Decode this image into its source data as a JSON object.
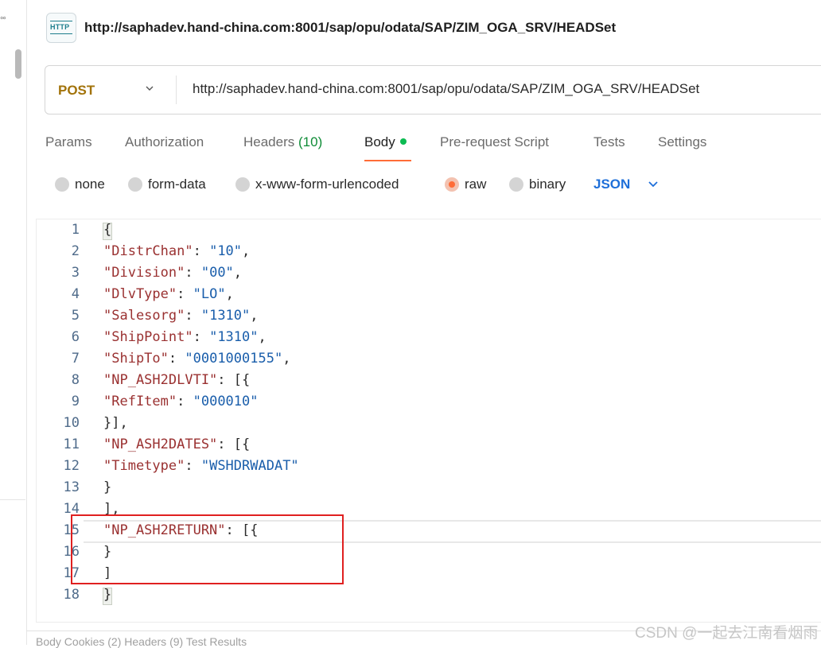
{
  "sidebar": {
    "dots": "°°"
  },
  "request": {
    "title_url": "http://saphadev.hand-china.com:8001/sap/opu/odata/SAP/ZIM_OGA_SRV/HEADSet",
    "method": "POST",
    "url": "http://saphadev.hand-china.com:8001/sap/opu/odata/SAP/ZIM_OGA_SRV/HEADSet",
    "icon_label": "HTTP"
  },
  "tabs": [
    {
      "label": "Params"
    },
    {
      "label": "Authorization"
    },
    {
      "label": "Headers",
      "count": "(10)"
    },
    {
      "label": "Body",
      "active": true
    },
    {
      "label": "Pre-request Script"
    },
    {
      "label": "Tests"
    },
    {
      "label": "Settings"
    }
  ],
  "body_types": [
    {
      "label": "none",
      "selected": false
    },
    {
      "label": "form-data",
      "selected": false
    },
    {
      "label": "x-www-form-urlencoded",
      "selected": false
    },
    {
      "label": "raw",
      "selected": true
    },
    {
      "label": "binary",
      "selected": false
    }
  ],
  "format": "JSON",
  "editor": {
    "line_numbers": [
      "1",
      "2",
      "3",
      "4",
      "5",
      "6",
      "7",
      "8",
      "9",
      "10",
      "11",
      "12",
      "13",
      "14",
      "15",
      "16",
      "17",
      "18"
    ],
    "lines": [
      {
        "parts": [
          {
            "t": "p",
            "v": "{"
          }
        ]
      },
      {
        "parts": [
          {
            "t": "k",
            "v": "\"DistrChan\""
          },
          {
            "t": "p",
            "v": ": "
          },
          {
            "t": "s",
            "v": "\"10\""
          },
          {
            "t": "p",
            "v": ","
          }
        ]
      },
      {
        "parts": [
          {
            "t": "k",
            "v": "\"Division\""
          },
          {
            "t": "p",
            "v": ": "
          },
          {
            "t": "s",
            "v": "\"00\""
          },
          {
            "t": "p",
            "v": ","
          }
        ]
      },
      {
        "parts": [
          {
            "t": "k",
            "v": "\"DlvType\""
          },
          {
            "t": "p",
            "v": ": "
          },
          {
            "t": "s",
            "v": "\"LO\""
          },
          {
            "t": "p",
            "v": ","
          }
        ]
      },
      {
        "parts": [
          {
            "t": "k",
            "v": "\"Salesorg\""
          },
          {
            "t": "p",
            "v": ": "
          },
          {
            "t": "s",
            "v": "\"1310\""
          },
          {
            "t": "p",
            "v": ","
          }
        ]
      },
      {
        "parts": [
          {
            "t": "k",
            "v": "\"ShipPoint\""
          },
          {
            "t": "p",
            "v": ": "
          },
          {
            "t": "s",
            "v": "\"1310\""
          },
          {
            "t": "p",
            "v": ","
          }
        ]
      },
      {
        "parts": [
          {
            "t": "k",
            "v": "\"ShipTo\""
          },
          {
            "t": "p",
            "v": ": "
          },
          {
            "t": "s",
            "v": "\"0001000155\""
          },
          {
            "t": "p",
            "v": ","
          }
        ]
      },
      {
        "parts": [
          {
            "t": "k",
            "v": "\"NP_ASH2DLVTI\""
          },
          {
            "t": "p",
            "v": ": [{"
          }
        ]
      },
      {
        "parts": [
          {
            "t": "k",
            "v": "\"RefItem\""
          },
          {
            "t": "p",
            "v": ": "
          },
          {
            "t": "s",
            "v": "\"000010\""
          }
        ]
      },
      {
        "parts": [
          {
            "t": "p",
            "v": "}],"
          }
        ]
      },
      {
        "parts": [
          {
            "t": "k",
            "v": "\"NP_ASH2DATES\""
          },
          {
            "t": "p",
            "v": ": [{"
          }
        ]
      },
      {
        "parts": [
          {
            "t": "k",
            "v": "\"Timetype\""
          },
          {
            "t": "p",
            "v": ": "
          },
          {
            "t": "s",
            "v": "\"WSHDRWADAT\""
          }
        ]
      },
      {
        "parts": [
          {
            "t": "p",
            "v": "}"
          }
        ]
      },
      {
        "parts": [
          {
            "t": "p",
            "v": "],"
          }
        ]
      },
      {
        "parts": [
          {
            "t": "k",
            "v": "\"NP_ASH2RETURN\""
          },
          {
            "t": "p",
            "v": ": [{"
          }
        ]
      },
      {
        "parts": [
          {
            "t": "p",
            "v": "}"
          }
        ]
      },
      {
        "parts": [
          {
            "t": "p",
            "v": "]"
          }
        ]
      },
      {
        "parts": [
          {
            "t": "p",
            "v": "}"
          }
        ]
      }
    ]
  },
  "footer": {
    "text": "Body   Cookies (2)   Headers (9)   Test Results"
  },
  "watermark": "CSDN @一起去江南看烟雨",
  "colors": {
    "accent": "#ff6c37",
    "method": "#a2730a",
    "json_blue": "#1e6fd9",
    "annotation": "#e02020"
  }
}
